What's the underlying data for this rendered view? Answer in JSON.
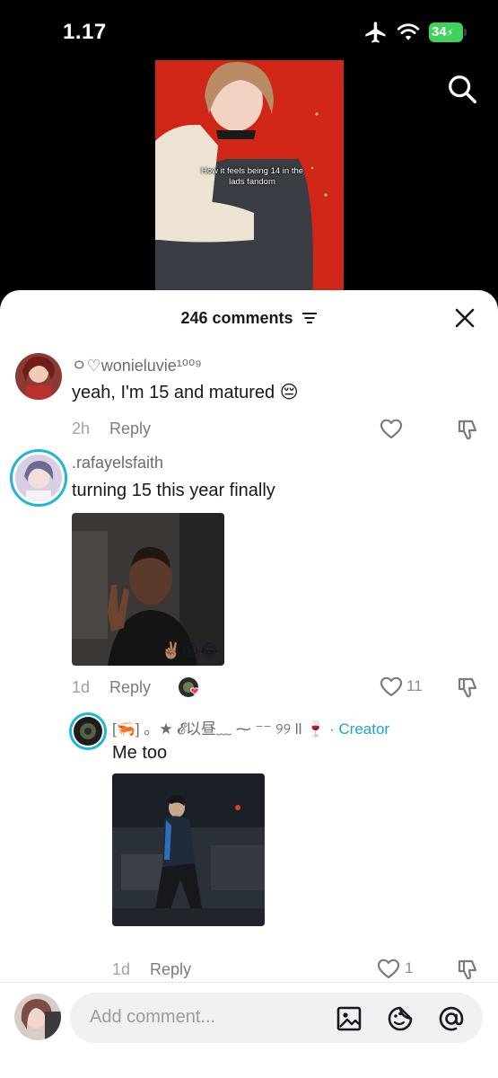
{
  "status_bar": {
    "time": "1.17",
    "battery": "34"
  },
  "video": {
    "caption": "How it feels being 14 in the lads fandom"
  },
  "sheet": {
    "comment_count_label": "246 comments"
  },
  "comments": [
    {
      "username": "ㅇ♡wonieluvie¹⁰⁰⁹",
      "text": "yeah, I'm 15 and matured 😔",
      "time": "2h",
      "reply_label": "Reply",
      "like_count": ""
    },
    {
      "username": ".rafayelsfaith",
      "text": "turning 15 this year finally",
      "time": "1d",
      "reply_label": "Reply",
      "like_count": "11",
      "media_overlay": "✌🏽😭😂"
    },
    {
      "username": "[🦐] 。★ 𝓔以昼﹏ ⁓ ⁻⁻ ୨୨ ll 🍷",
      "creator_label": "· Creator",
      "text": "Me too",
      "time": "1d",
      "reply_label": "Reply",
      "like_count": "1"
    }
  ],
  "bottom_bar": {
    "placeholder": "Add comment..."
  },
  "colors": {
    "accent_creator": "#1ba3d8",
    "video_bg": "#d42a1c",
    "battery": "#3fd25c"
  }
}
